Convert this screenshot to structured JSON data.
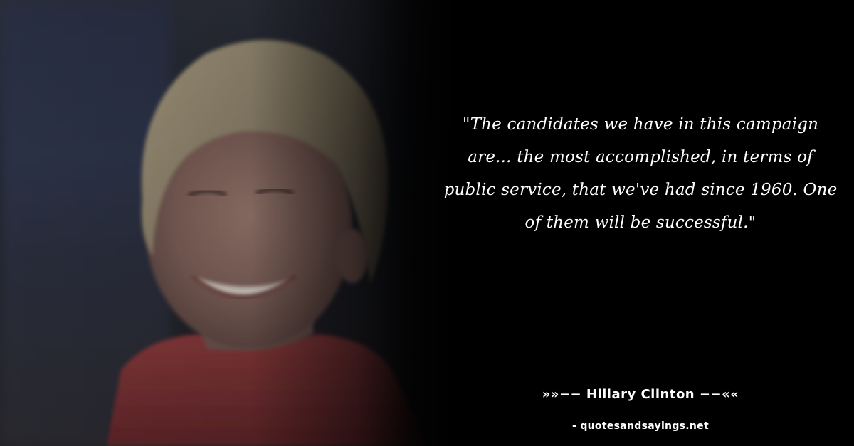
{
  "quote": {
    "text": "\"The candidates we have in this campaign are... the most accomplished, in terms of public service, that we've had since 1960. One of them will be successful.\""
  },
  "author": {
    "line": "»»−− Hillary Clinton −−««"
  },
  "source": {
    "text": "- quotesandsayings.net"
  },
  "colors": {
    "background": "#000000",
    "text": "#ffffff"
  }
}
